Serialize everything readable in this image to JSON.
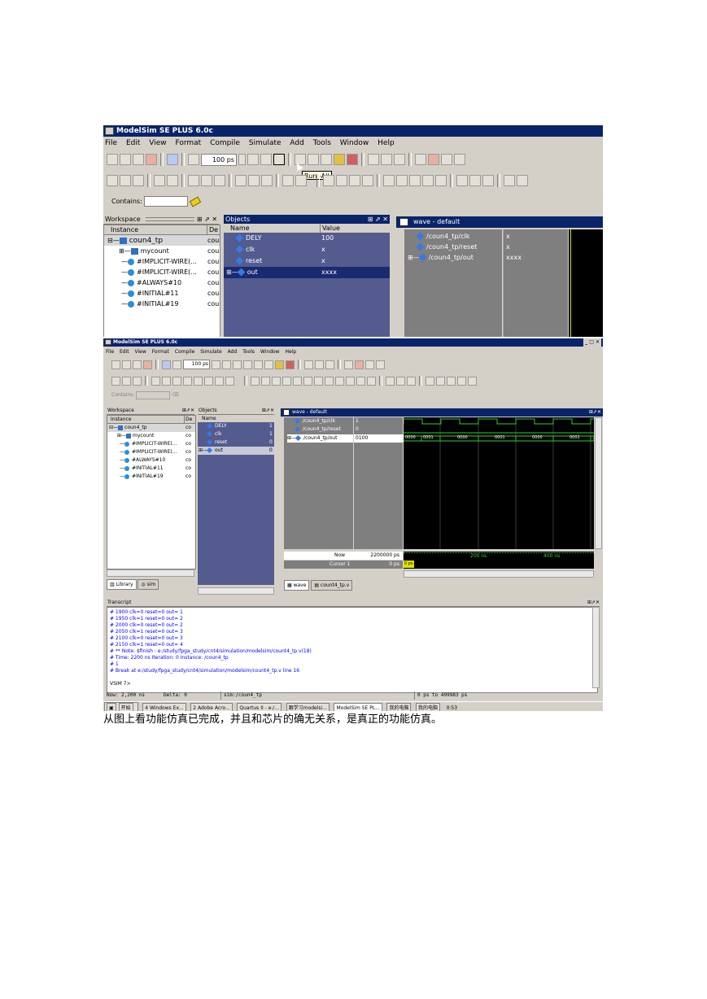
{
  "s1": {
    "title": "ModelSim SE PLUS 6.0c",
    "menu": [
      "File",
      "Edit",
      "View",
      "Format",
      "Compile",
      "Simulate",
      "Add",
      "Tools",
      "Window",
      "Help"
    ],
    "time_value": "100 ps",
    "tooltip": "Run -All",
    "contains_label": "Contains:",
    "workspace_label": "Workspace",
    "col_instance": "Instance",
    "col_de": "De",
    "tree": [
      "coun4_tp",
      "mycount",
      "#IMPLICIT-WIRE(...",
      "#IMPLICIT-WIRE(...",
      "#ALWAYS#10",
      "#INITIAL#11",
      "#INITIAL#19"
    ],
    "tree_de": "cou",
    "objects_label": "Objects",
    "col_name": "Name",
    "col_value": "Value",
    "objects": [
      {
        "name": "DELY",
        "value": "100"
      },
      {
        "name": "clk",
        "value": "x"
      },
      {
        "name": "reset",
        "value": "x"
      },
      {
        "name": "out",
        "value": "xxxx"
      }
    ],
    "wave_title": "wave - default",
    "signals": [
      {
        "name": "/coun4_tp/clk",
        "value": "x"
      },
      {
        "name": "/coun4_tp/reset",
        "value": "x"
      },
      {
        "name": "/coun4_tp/out",
        "value": "xxxx"
      }
    ]
  },
  "s2": {
    "title": "ModelSim SE PLUS 6.0c",
    "menu": [
      "File",
      "Edit",
      "View",
      "Format",
      "Compile",
      "Simulate",
      "Add",
      "Tools",
      "Window",
      "Help"
    ],
    "time_value": "100 ps",
    "contains_label": "Contains:",
    "workspace_label": "Workspace",
    "col_instance": "Instance",
    "col_de": "De",
    "tree": [
      "coun4_tp",
      "mycount",
      "#IMPLICIT-WIRE(...",
      "#IMPLICIT-WIRE(...",
      "#ALWAYS#10",
      "#INITIAL#11",
      "#INITIAL#19"
    ],
    "tree_de": "co",
    "objects_label": "Objects",
    "col_name": "Name",
    "objects": [
      {
        "name": "DELY",
        "value": "1"
      },
      {
        "name": "clk",
        "value": "1"
      },
      {
        "name": "reset",
        "value": "0"
      },
      {
        "name": "out",
        "value": "0"
      }
    ],
    "wave_title": "wave - default",
    "signals": [
      {
        "name": "/coun4_tp/clk",
        "value": "1"
      },
      {
        "name": "/coun4_tp/reset",
        "value": "0"
      },
      {
        "name": "/coun4_tp/out",
        "value": "0100"
      }
    ],
    "out_values": [
      "0000",
      "0001",
      "0000",
      "0001",
      "0000",
      "0001"
    ],
    "now_label": "Now",
    "now_value": "2200000 ps",
    "cursor_label": "Cursor 1",
    "cursor_value": "0 ps",
    "cursor_tag": "0 ps",
    "ruler_200": "200 ns",
    "ruler_400": "400 ns",
    "tab_library": "Library",
    "tab_sim": "sim",
    "tab_wave": "wave",
    "tab_file": "count4_tp.v",
    "transcript_label": "Transcript",
    "transcript": [
      "#            1900  clk=0 reset=0 out= 1",
      "#            1950  clk=1 reset=0 out= 2",
      "#            2000  clk=0 reset=0 out= 2",
      "#            2050  clk=1 reset=0 out= 3",
      "#            2100  clk=0 reset=0 out= 3",
      "#            2150  clk=1 reset=0 out= 4",
      "# ** Note: $finish    : e:/study/fpga_study/cnt4/simulation/modelsim/count4_tp.v(18)",
      "#    Time: 2200 ns  Iteration: 0  Instance: /coun4_tp",
      "# 1",
      "# Break at e:/study/fpga_study/cnt4/simulation/modelsim/count4_tp.v line 16",
      "",
      "VSIM 7>"
    ],
    "status_now": "Now: 2,200 ns",
    "status_delta": "Delta: 0",
    "status_sim": "sim:/coun4_tp",
    "status_range": "0 ps to 499983 ps",
    "taskbar": [
      "开始",
      "4 Windows Ex...",
      "2 Adobe Acro...",
      "Quartus II - e:/...",
      "跟学习modelsi...",
      "ModelSim SE PL...",
      "我的电脑",
      "我的电脑",
      "0:53"
    ]
  },
  "caption": "从图上看功能仿真已完成，并且和芯片的确无关系，是真正的功能仿真。"
}
